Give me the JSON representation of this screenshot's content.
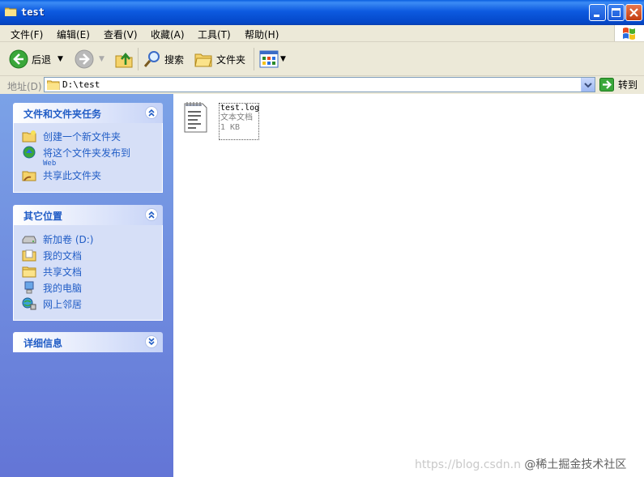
{
  "window": {
    "title": "test"
  },
  "menu": [
    {
      "label": "文件(F)"
    },
    {
      "label": "编辑(E)"
    },
    {
      "label": "查看(V)"
    },
    {
      "label": "收藏(A)"
    },
    {
      "label": "工具(T)"
    },
    {
      "label": "帮助(H)"
    }
  ],
  "toolbar": {
    "back_label": "后退",
    "search_label": "搜索",
    "folders_label": "文件夹"
  },
  "address": {
    "label": "地址(D)",
    "value": "D:\\test",
    "go_label": "转到"
  },
  "panels": {
    "tasks": {
      "title": "文件和文件夹任务",
      "items": [
        {
          "label": "创建一个新文件夹",
          "icon": "new-folder-icon"
        },
        {
          "label": "将这个文件夹发布到",
          "sub": "Web",
          "icon": "publish-web-icon"
        },
        {
          "label": "共享此文件夹",
          "icon": "share-folder-icon"
        }
      ]
    },
    "places": {
      "title": "其它位置",
      "items": [
        {
          "label": "新加卷 (D:)",
          "icon": "drive-icon"
        },
        {
          "label": "我的文档",
          "icon": "my-documents-icon"
        },
        {
          "label": "共享文档",
          "icon": "shared-documents-icon"
        },
        {
          "label": "我的电脑",
          "icon": "my-computer-icon"
        },
        {
          "label": "网上邻居",
          "icon": "network-icon"
        }
      ]
    },
    "details": {
      "title": "详细信息"
    }
  },
  "files": [
    {
      "name": "test.log",
      "type": "文本文档",
      "size": "1 KB",
      "icon": "text-document-icon"
    }
  ],
  "watermark": {
    "url": "https://blog.csdn.n",
    "brand": "@稀土掘金技术社区"
  },
  "colors": {
    "title_bar": "#0a5fe0",
    "left_pane": "#7ba2e7",
    "panel_link": "#215dc6",
    "chrome": "#ece9d8"
  }
}
